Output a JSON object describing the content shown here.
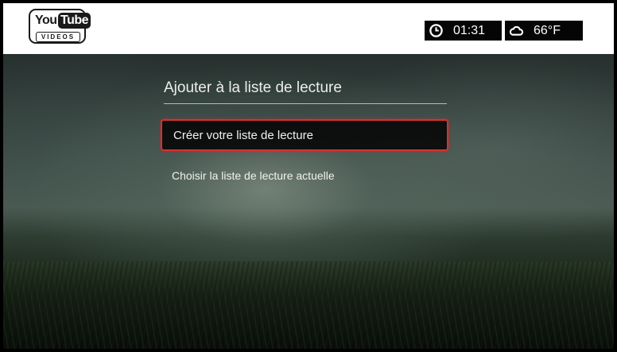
{
  "header": {
    "logo": {
      "you": "You",
      "tube": "Tube",
      "sub": "VIDEOS"
    },
    "clock": {
      "icon": "clock-icon",
      "value": "01:31"
    },
    "weather": {
      "icon": "cloud-icon",
      "value": "66°F"
    }
  },
  "dialog": {
    "title": "Ajouter à la liste de lecture",
    "items": [
      {
        "label": "Créer votre liste de lecture",
        "selected": true
      },
      {
        "label": "Choisir la liste de lecture actuelle",
        "selected": false
      }
    ]
  },
  "colors": {
    "highlight": "#d8302f",
    "topbar": "#ffffff",
    "status_bg": "#050505"
  }
}
